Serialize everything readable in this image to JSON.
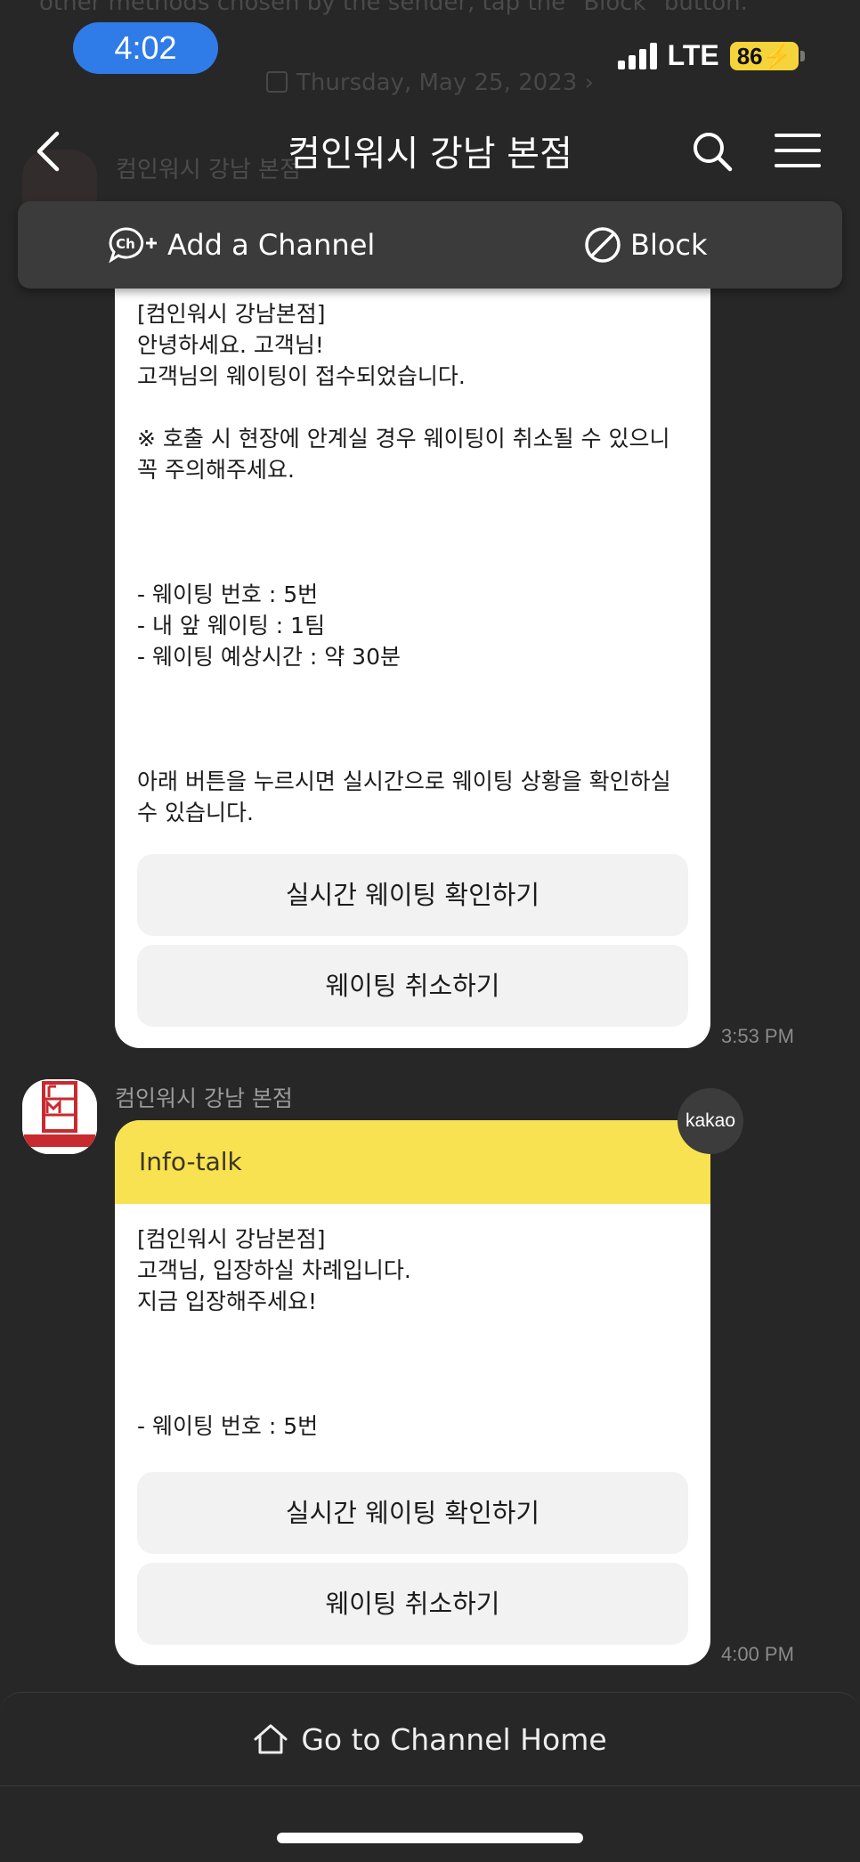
{
  "background": {
    "partial_text": "other methods chosen by the sender, tap the \"Block\" button.",
    "date": "Thursday, May 25, 2023",
    "sender_name": "컴인워시 강남 본점"
  },
  "status_bar": {
    "time": "4:02",
    "network": "LTE",
    "battery": "86"
  },
  "header": {
    "title": "컴인워시 강남 본점"
  },
  "channel_actions": {
    "add_label": "Add a Channel",
    "block_label": "Block"
  },
  "messages": [
    {
      "body": "[컴인워시 강남본점]\n안녕하세요. 고객님!\n고객님의 웨이팅이 접수되었습니다.\n\n※ 호출 시 현장에 안계실 경우 웨이팅이 취소될 수 있으니\n꼭 주의해주세요.\n\n\n\n- 웨이팅 번호 : 5번\n- 내 앞 웨이팅 : 1팀\n- 웨이팅 예상시간 : 약 30분\n\n\n\n아래 버튼을 누르시면 실시간으로 웨이팅 상황을 확인하실\n수 있습니다.",
      "buttons": [
        "실시간 웨이팅 확인하기",
        "웨이팅 취소하기"
      ],
      "time": "3:53 PM"
    },
    {
      "sender": "컴인워시 강남 본점",
      "badge": "kakao",
      "header": "Info-talk",
      "body": "[컴인워시 강남본점]\n고객님, 입장하실 차례입니다.\n지금 입장해주세요!\n\n\n\n- 웨이팅 번호 : 5번",
      "buttons": [
        "실시간 웨이팅 확인하기",
        "웨이팅 취소하기"
      ],
      "time": "4:00 PM"
    }
  ],
  "footer": {
    "home_label": "Go to Channel Home"
  },
  "colors": {
    "background": "#272727",
    "info_talk_header": "#f9e251",
    "status_time_pill": "#2f7ce8",
    "battery": "#f5d33a"
  }
}
